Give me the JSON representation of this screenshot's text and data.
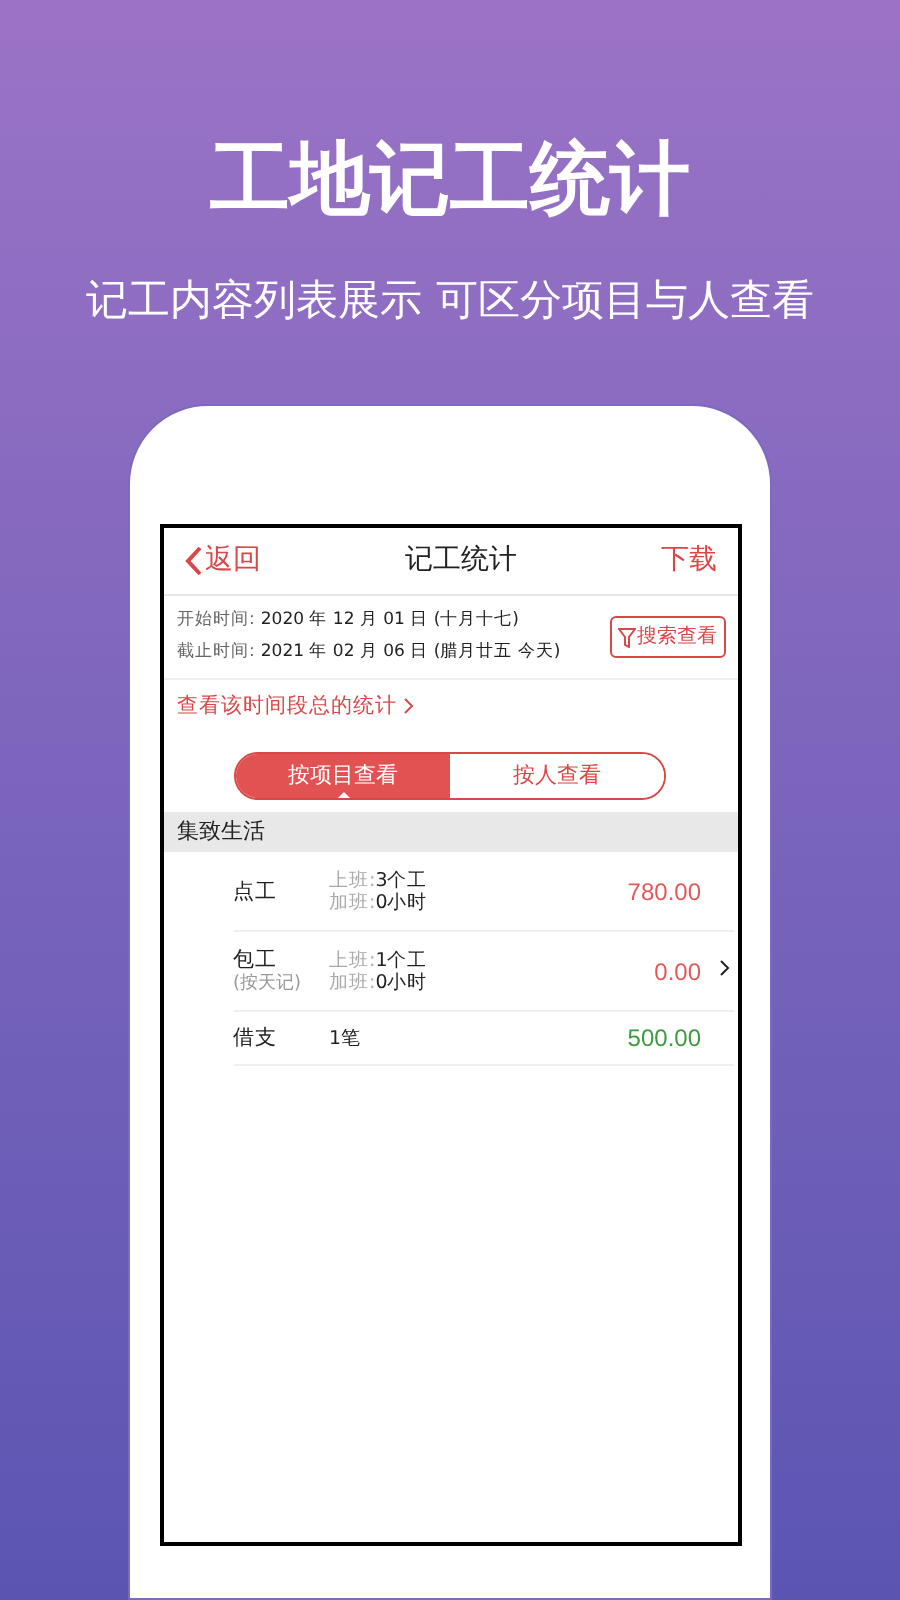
{
  "headline": "工地记工统计",
  "subtitle": "记工内容列表展示 可区分项目与人查看",
  "nav": {
    "back": "返回",
    "title": "记工统计",
    "action": "下载"
  },
  "period": [
    {
      "label": "开始时间:",
      "value": "2020 年 12 月 01 日 (十月十七)"
    },
    {
      "label": "截止时间:",
      "value": "2021 年 02 月 06 日 (腊月廿五 今天)"
    }
  ],
  "search_button": "搜索查看",
  "summary_link": "查看该时间段总的统计",
  "tabs": [
    {
      "label": "按项目查看",
      "selected": true
    },
    {
      "label": "按人查看",
      "selected": false
    }
  ],
  "group": "集致生活",
  "rows": [
    {
      "name": "点工",
      "lines": [
        {
          "label": "上班:",
          "value": "3个工"
        },
        {
          "label": "加班:",
          "value": "0小时"
        }
      ],
      "amount": "780.00",
      "color": "#e05a5a",
      "arrow": false
    },
    {
      "name": "包工",
      "note": "(按天记)",
      "lines": [
        {
          "label": "上班:",
          "value": "1个工"
        },
        {
          "label": "加班:",
          "value": "0小时"
        }
      ],
      "amount": "0.00",
      "color": "#e05a5a",
      "arrow": true
    },
    {
      "name": "借支",
      "lines": [
        {
          "value": "1笔"
        }
      ],
      "amount": "500.00",
      "color": "#3f9a3f",
      "arrow": false
    }
  ]
}
